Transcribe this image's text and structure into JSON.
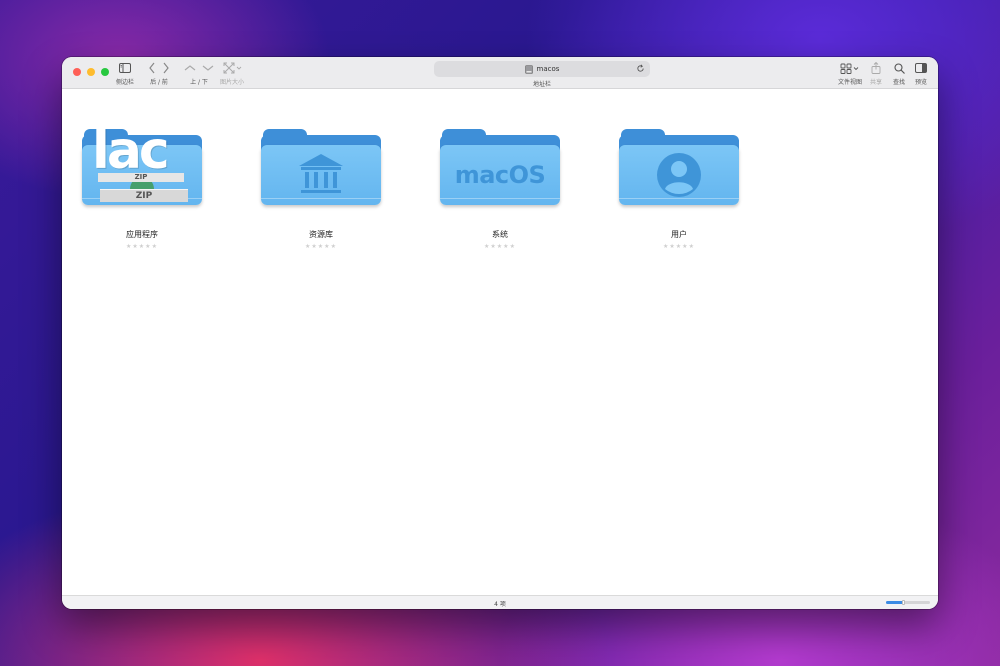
{
  "window": {
    "traffic_lights": [
      {
        "name": "close-button",
        "color": "#fe5f57"
      },
      {
        "name": "minimize-button",
        "color": "#febc2e"
      },
      {
        "name": "zoom-button",
        "color": "#28c840"
      }
    ]
  },
  "toolbar": {
    "sidebar_label": "侧边栏",
    "back_forward_label": "后 / 前",
    "up_down_label": "上 / 下",
    "icon_size_label": "图片大小",
    "address": {
      "value": "macos",
      "label": "地址栏"
    },
    "view_label": "文件视图",
    "share_label": "共享",
    "search_label": "查找",
    "preview_label": "预览"
  },
  "items": [
    {
      "name": "应用程序",
      "badge": "lac",
      "zip_top": "ZIP",
      "zip_bottom": "ZIP",
      "stars": "★★★★★"
    },
    {
      "name": "资源库",
      "stars": "★★★★★"
    },
    {
      "name": "系统",
      "badge": "macOS",
      "stars": "★★★★★"
    },
    {
      "name": "用户",
      "stars": "★★★★★"
    }
  ],
  "status": {
    "count": "4 项",
    "icon_size_level": 0.4
  },
  "colors": {
    "accent": "#3b8be4",
    "folder_back": "#3e8fd8",
    "folder_front": "#70bdf3"
  }
}
